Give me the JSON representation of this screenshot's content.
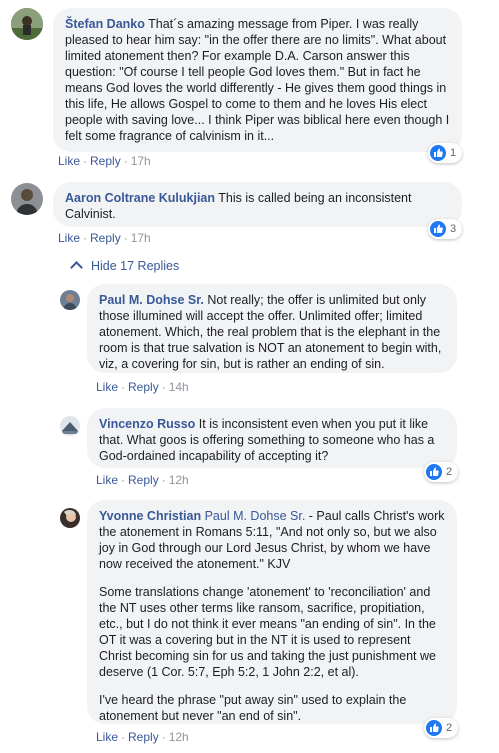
{
  "comments": [
    {
      "author": "Štefan Danko",
      "text": " That´s amazing message from Piper. I was really pleased to hear him say: \"in the offer there are no limits\". What about limited atonement then? For example D.A. Carson answer this question: \"Of course I tell people God loves them.\" But in fact he means God loves the world differently - He gives them good things in this life, He allows Gospel to come to them and he loves His elect people with saving love... I think Piper was biblical here even though I felt some fragrance of calvinism in it...",
      "like": "Like",
      "reply": "Reply",
      "time": "17h",
      "reactions": "1"
    },
    {
      "author": "Aaron Coltrane Kulukjian",
      "text": " This is called being an inconsistent Calvinist.",
      "like": "Like",
      "reply": "Reply",
      "time": "17h",
      "reactions": "3"
    }
  ],
  "hide_replies": "Hide 17 Replies",
  "replies": [
    {
      "author": "Paul M. Dohse Sr.",
      "text": " Not really; the offer is unlimited but only those illumined will accept the offer. Unlimited offer; limited atonement. Which, the real problem that is the elephant in the room is that true salvation is NOT an atonement to begin with, viz, a covering for sin, but is rather an ending of sin.",
      "like": "Like",
      "reply": "Reply",
      "time": "14h"
    },
    {
      "author": "Vincenzo Russo",
      "text": " It is inconsistent even when you put it like that. What goos is offering something to someone who has a God-ordained incapability of accepting it?",
      "like": "Like",
      "reply": "Reply",
      "time": "12h",
      "reactions": "2"
    },
    {
      "author": "Yvonne Christian",
      "tag": " Paul M. Dohse Sr.",
      "text1": " - Paul calls Christ's work the atonement in Romans 5:11, \"And not only so, but we also joy in God through our Lord Jesus Christ, by whom we have now received the atonement.\" KJV",
      "text2": "Some translations change 'atonement' to 'reconciliation' and the NT uses other terms like ransom, sacrifice, propitiation, etc., but I do not think it ever means \"an ending of sin\". In the OT it was a covering but in the NT it is used to represent Christ becoming sin for us and taking the just punishment we deserve (1 Cor. 5:7, Eph 5:2, 1 John 2:2, et al).",
      "text3": "I've heard the phrase \"put away sin\" used to explain the atonement but never \"an end of sin\".",
      "like": "Like",
      "reply": "Reply",
      "time": "12h",
      "reactions": "2"
    }
  ],
  "colors": {
    "link": "#385898",
    "bubble": "#f2f3f5",
    "like_blue": "#2078f4",
    "meta": "#90949c"
  }
}
